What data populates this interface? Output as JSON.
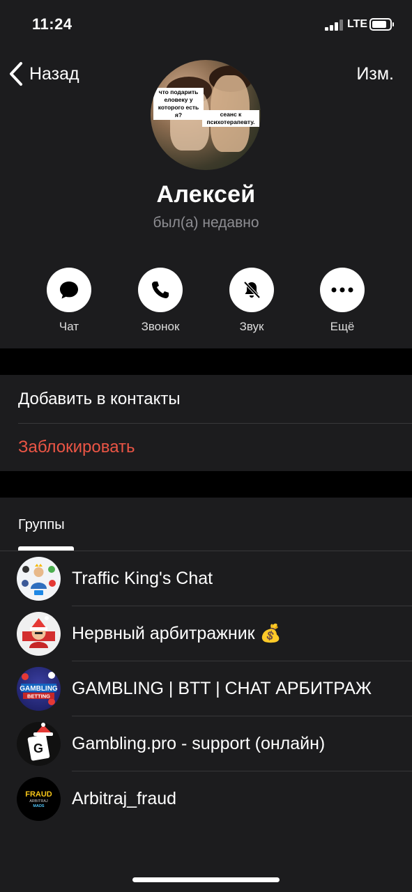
{
  "status_bar": {
    "time": "11:24",
    "network": "LTE"
  },
  "nav": {
    "back_label": "Назад",
    "edit_label": "Изм."
  },
  "profile": {
    "name": "Алексей",
    "last_seen": "был(а) недавно",
    "avatar_caption_1": "что подарить еловеку у которого есть я?",
    "avatar_caption_2": "сеанс к психотерапевту."
  },
  "actions": [
    {
      "label": "Чат",
      "icon": "chat-bubble-icon"
    },
    {
      "label": "Звонок",
      "icon": "phone-icon"
    },
    {
      "label": "Звук",
      "icon": "bell-muted-icon"
    },
    {
      "label": "Ещё",
      "icon": "more-dots-icon"
    }
  ],
  "contact_actions": {
    "add_contact": "Добавить в контакты",
    "block": "Заблокировать"
  },
  "groups": {
    "title": "Группы",
    "items": [
      {
        "name": "Traffic King's Chat",
        "avatar_text": ""
      },
      {
        "name": "Нервный арбитражник 💰",
        "avatar_text": ""
      },
      {
        "name": "GAMBLING | BTT | CHAT АРБИТРАЖ",
        "avatar_text": "GAMBLING BETTING"
      },
      {
        "name": "Gambling.pro - support (онлайн)",
        "avatar_text": "G"
      },
      {
        "name": "Arbitraj_fraud",
        "avatar_text": "FRAUD ARBITRAJ MADS"
      }
    ]
  },
  "colors": {
    "background": "#000000",
    "surface": "#1c1c1e",
    "danger": "#eb5545",
    "secondary_text": "#8e8e93"
  }
}
